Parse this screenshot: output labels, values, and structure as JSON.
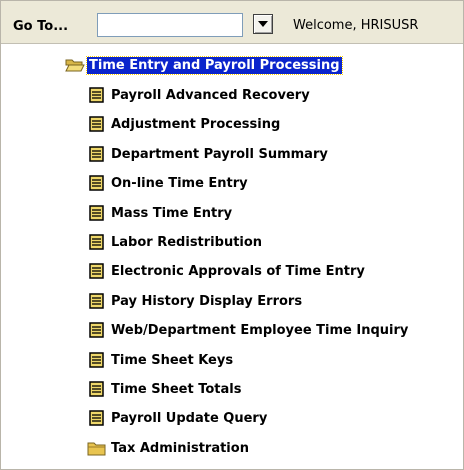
{
  "toolbar": {
    "goto_label": "Go To...",
    "goto_value": "",
    "welcome_text": "Welcome, HRISUSR"
  },
  "tree": {
    "root": {
      "label": "Time Entry and Payroll Processing",
      "icon": "open-folder-icon",
      "selected": true
    },
    "items": [
      {
        "label": "Payroll Advanced Recovery",
        "icon": "form-icon"
      },
      {
        "label": "Adjustment Processing",
        "icon": "form-icon"
      },
      {
        "label": "Department Payroll Summary",
        "icon": "form-icon"
      },
      {
        "label": "On-line Time Entry",
        "icon": "form-icon"
      },
      {
        "label": "Mass Time Entry",
        "icon": "form-icon"
      },
      {
        "label": "Labor Redistribution",
        "icon": "form-icon"
      },
      {
        "label": "Electronic Approvals of Time Entry",
        "icon": "form-icon"
      },
      {
        "label": "Pay History Display Errors",
        "icon": "form-icon"
      },
      {
        "label": "Web/Department Employee Time Inquiry",
        "icon": "form-icon"
      },
      {
        "label": "Time Sheet Keys",
        "icon": "form-icon"
      },
      {
        "label": "Time Sheet Totals",
        "icon": "form-icon"
      },
      {
        "label": "Payroll Update Query",
        "icon": "form-icon"
      },
      {
        "label": "Tax Administration",
        "icon": "folder-icon"
      }
    ]
  },
  "colors": {
    "selection_bg": "#0a24cc",
    "selection_text": "#ffffff",
    "form_icon_fill": "#efd86a",
    "folder_icon_fill": "#e8c450"
  }
}
